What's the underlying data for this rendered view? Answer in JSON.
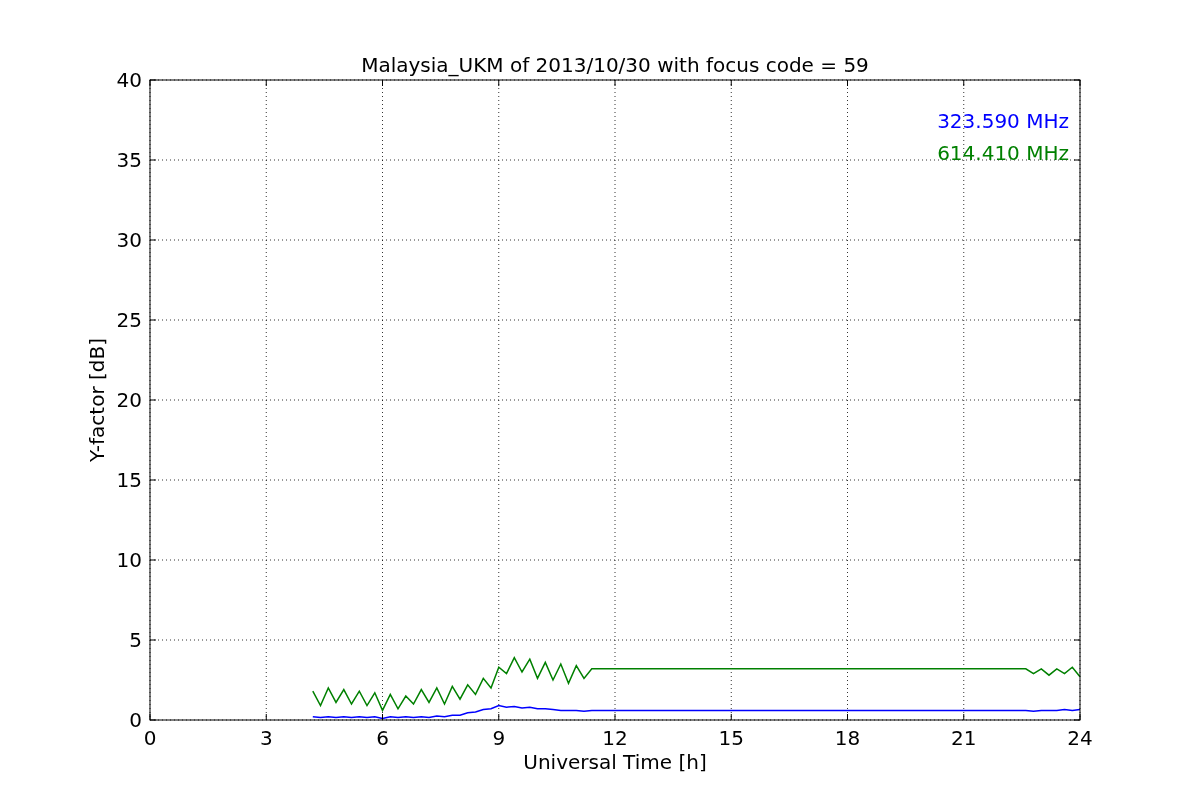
{
  "chart_data": {
    "type": "line",
    "title": "Malaysia_UKM of 2013/10/30 with focus code = 59",
    "xlabel": "Universal Time [h]",
    "ylabel": "Y-factor [dB]",
    "x": [
      4.2,
      4.4,
      4.6,
      4.8,
      5.0,
      5.2,
      5.4,
      5.6,
      5.8,
      6.0,
      6.2,
      6.4,
      6.6,
      6.8,
      7.0,
      7.2,
      7.4,
      7.6,
      7.8,
      8.0,
      8.2,
      8.4,
      8.6,
      8.8,
      9.0,
      9.2,
      9.4,
      9.6,
      9.8,
      10.0,
      10.2,
      10.4,
      10.6,
      10.8,
      11.0,
      11.2,
      11.4,
      22.6,
      22.8,
      23.0,
      23.2,
      23.4,
      23.6,
      23.8,
      24.0
    ],
    "series": [
      {
        "name": "323.590 MHz",
        "color": "#0000ff",
        "values": [
          0.2,
          0.15,
          0.2,
          0.15,
          0.2,
          0.15,
          0.2,
          0.15,
          0.2,
          0.1,
          0.2,
          0.15,
          0.2,
          0.15,
          0.2,
          0.15,
          0.25,
          0.2,
          0.3,
          0.3,
          0.45,
          0.5,
          0.65,
          0.7,
          0.9,
          0.8,
          0.85,
          0.75,
          0.8,
          0.7,
          0.7,
          0.65,
          0.6,
          0.6,
          0.6,
          0.55,
          0.6,
          0.6,
          0.55,
          0.6,
          0.6,
          0.6,
          0.65,
          0.6,
          0.65
        ]
      },
      {
        "name": "614.410 MHz",
        "color": "#008000",
        "values": [
          1.8,
          0.9,
          2.0,
          1.1,
          1.9,
          1.0,
          1.8,
          0.9,
          1.7,
          0.6,
          1.6,
          0.7,
          1.5,
          1.0,
          1.9,
          1.1,
          2.0,
          1.0,
          2.1,
          1.3,
          2.2,
          1.6,
          2.6,
          2.0,
          3.3,
          2.9,
          3.9,
          3.0,
          3.8,
          2.6,
          3.6,
          2.5,
          3.5,
          2.3,
          3.4,
          2.6,
          3.2,
          3.2,
          2.9,
          3.2,
          2.8,
          3.2,
          2.9,
          3.3,
          2.7
        ]
      }
    ],
    "grid": true,
    "xlim": [
      0,
      24
    ],
    "ylim": [
      0,
      40
    ],
    "xticks": [
      0,
      3,
      6,
      9,
      12,
      15,
      18,
      21,
      24
    ],
    "yticks": [
      0,
      5,
      10,
      15,
      20,
      25,
      30,
      35,
      40
    ]
  }
}
